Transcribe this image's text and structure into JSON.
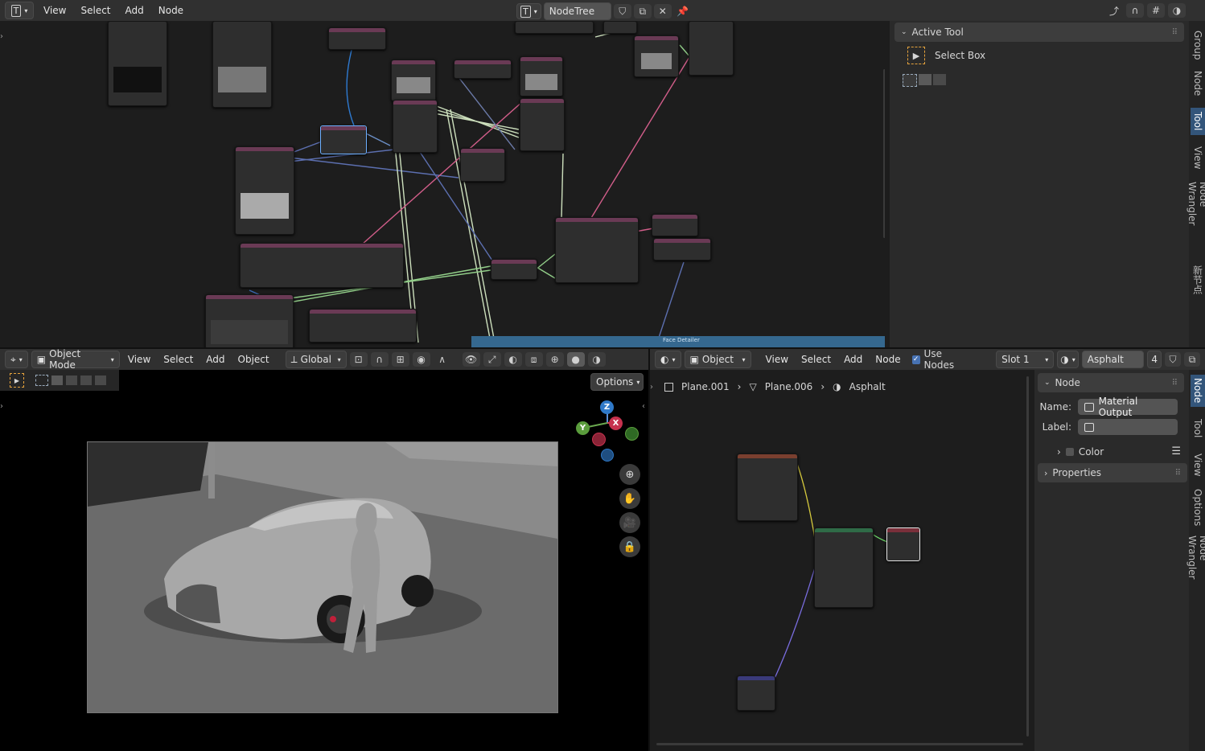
{
  "top_editor": {
    "menus": [
      "View",
      "Select",
      "Add",
      "Node"
    ],
    "tree_type_icon": "T",
    "tree_name": "NodeTree",
    "footer_label": "Face Detailer"
  },
  "active_tool": {
    "panel_title": "Active Tool",
    "tool_name": "Select Box"
  },
  "right_tabs_top": [
    "Group",
    "Node",
    "Tool",
    "View",
    "Node Wrangler",
    "新节点"
  ],
  "viewport": {
    "mode": "Object Mode",
    "menus": [
      "View",
      "Select",
      "Add",
      "Object"
    ],
    "orientation": "Global",
    "options_label": "Options",
    "gizmo_axes": [
      "Z",
      "X",
      "Y"
    ]
  },
  "shader_editor": {
    "object_dropdown": "Object",
    "menus": [
      "View",
      "Select",
      "Add",
      "Node"
    ],
    "use_nodes_label": "Use Nodes",
    "use_nodes_checked": true,
    "slot": "Slot 1",
    "material": "Asphalt",
    "user_count": "4",
    "breadcrumb": [
      "Plane.001",
      "Plane.006",
      "Asphalt"
    ]
  },
  "node_panel": {
    "title": "Node",
    "name_label": "Name:",
    "name_value": "Material Output",
    "label_label": "Label:",
    "label_value": "",
    "color_label": "Color",
    "properties_label": "Properties"
  },
  "right_tabs_bottom": [
    "Node",
    "Tool",
    "View",
    "Options",
    "Node Wrangler"
  ],
  "colors": {
    "accent": "#4772b3",
    "panel_header": "#3d3d3d",
    "node_comfy": "#6a3a55",
    "node_shader_green": "#2f6b47",
    "node_output_red": "#7a2f3a"
  }
}
